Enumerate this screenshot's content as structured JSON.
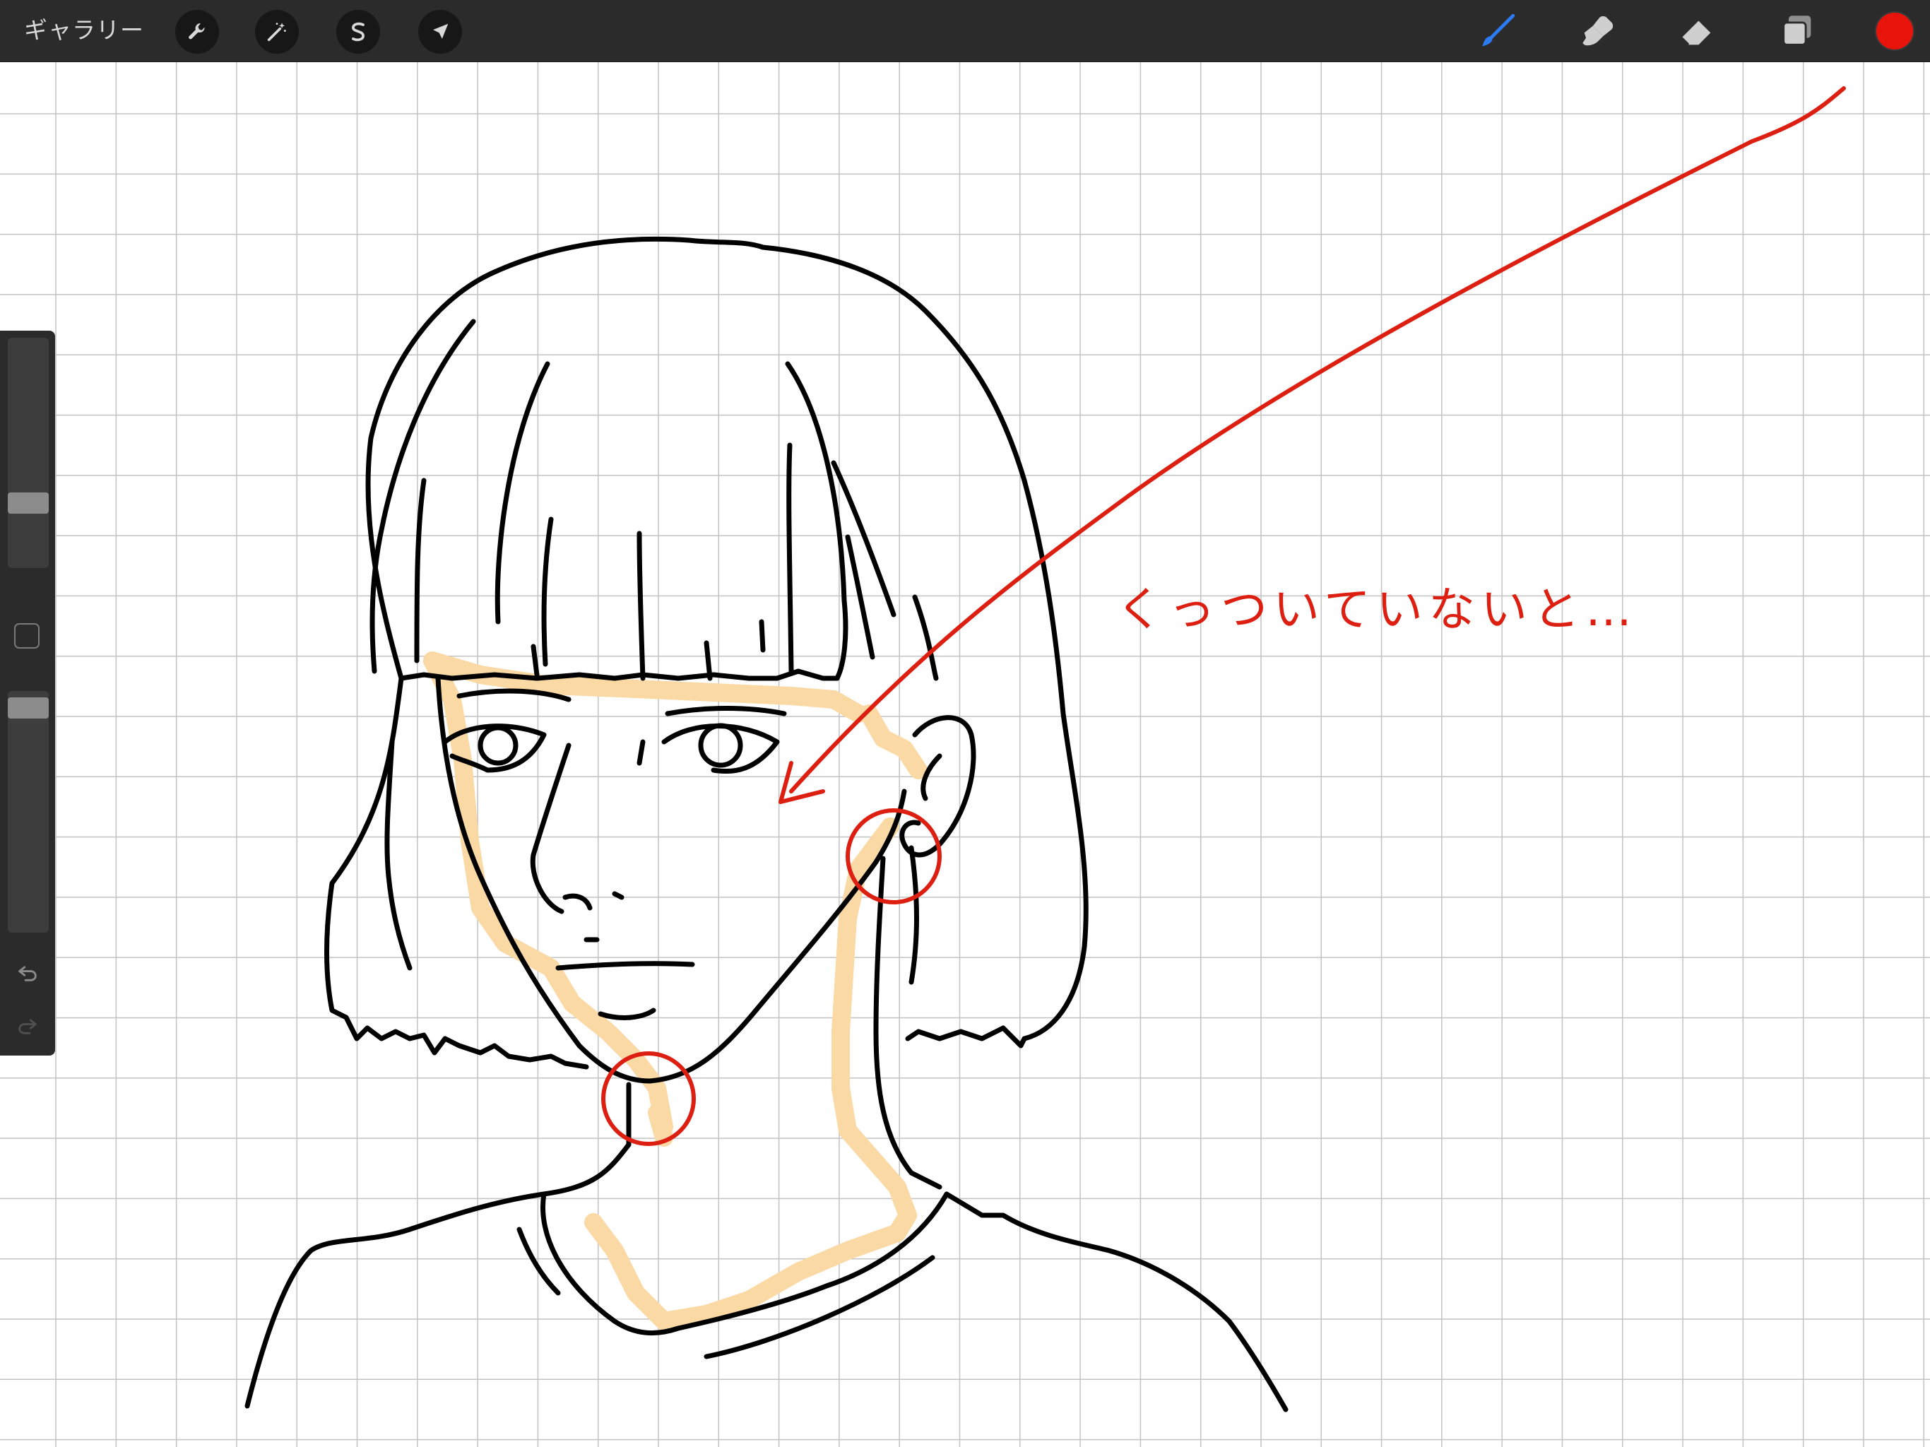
{
  "app": {
    "gallery_label": "ギャラリー",
    "annotation_text": "くっついていないと…"
  },
  "toolbar": {
    "left_tools": [
      {
        "name": "actions",
        "icon": "wrench-icon"
      },
      {
        "name": "adjustments",
        "icon": "magic-wand-icon"
      },
      {
        "name": "selection",
        "icon": "selection-s-icon"
      },
      {
        "name": "transform",
        "icon": "arrow-cursor-icon"
      }
    ],
    "right_tools": [
      {
        "name": "brush",
        "icon": "brush-icon",
        "active": true
      },
      {
        "name": "smudge",
        "icon": "smudge-icon",
        "active": false
      },
      {
        "name": "eraser",
        "icon": "eraser-icon",
        "active": false
      },
      {
        "name": "layers",
        "icon": "layers-icon",
        "active": false
      }
    ],
    "current_color": "#e8140c"
  },
  "sidebar": {
    "brush_size_level": 0.26,
    "opacity_level": 0.97,
    "undo_icon": "undo-icon",
    "redo_icon": "redo-icon"
  },
  "colors": {
    "topbar": "#2b2b2b",
    "active_tool": "#2d7cf6",
    "line_art": "#000000",
    "annotation_red": "#dd1f12",
    "skin_shade": "#fbd9a5",
    "grid": "#c2c2c2"
  }
}
